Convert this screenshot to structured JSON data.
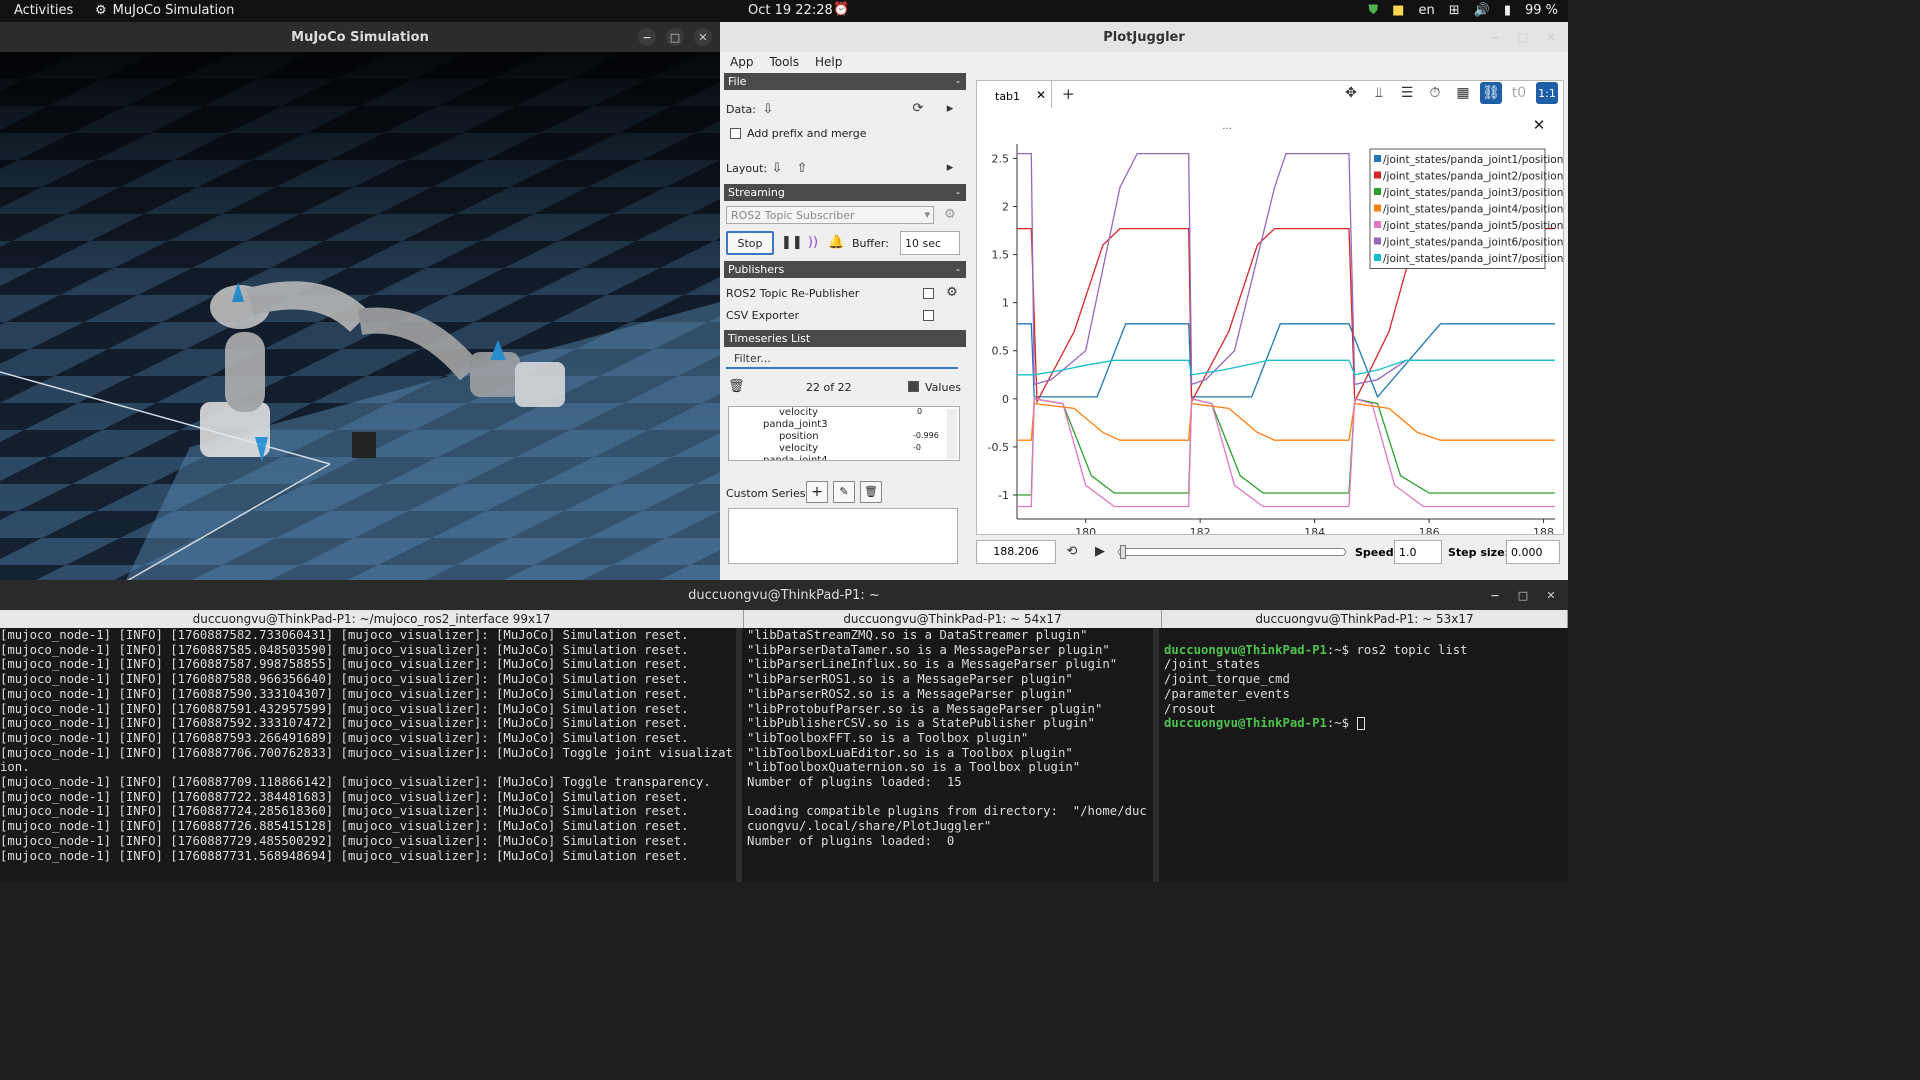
{
  "topbar": {
    "activities": "Activities",
    "app_name": "MuJoCo Simulation",
    "clock": "Oct 19  22:28",
    "lang": "en",
    "battery": "99 %"
  },
  "mujoco": {
    "title": "MuJoCo Simulation"
  },
  "plotjuggler": {
    "title": "PlotJuggler",
    "menu": [
      "App",
      "Tools",
      "Help"
    ],
    "file_section": "File",
    "data_label": "Data:",
    "prefix_label": "Add prefix and merge",
    "layout_label": "Layout:",
    "streaming_section": "Streaming",
    "streaming_source": "ROS2 Topic Subscriber",
    "stop_label": "Stop",
    "buffer_label": "Buffer:",
    "buffer_value": "10 sec",
    "publishers_section": "Publishers",
    "publishers": [
      "ROS2 Topic Re-Publisher",
      "CSV Exporter"
    ],
    "timeseries_section": "Timeseries List",
    "filter_placeholder": "Filter...",
    "count": "22 of 22",
    "values_label": "Values",
    "tree": [
      {
        "name": "velocity",
        "value": "0"
      },
      {
        "name": "panda_joint3",
        "value": ""
      },
      {
        "name": "position",
        "value": "-0.996"
      },
      {
        "name": "velocity",
        "value": "-0"
      },
      {
        "name": "panda_joint4",
        "value": ""
      }
    ],
    "custom_series_label": "Custom Series:",
    "tab_label": "tab1",
    "plot_dots": "...",
    "time_value": "188.206",
    "speed_label": "Speed:",
    "speed_value": "1.0",
    "step_label": "Step size:",
    "step_value": "0.000",
    "toolbar_zoom_label": "1:1"
  },
  "chart_data": {
    "type": "line",
    "title": "",
    "xlabel": "",
    "ylabel": "",
    "xlim": [
      178.8,
      188.2
    ],
    "ylim": [
      -1.25,
      2.65
    ],
    "xticks": [
      180,
      182,
      184,
      186,
      188
    ],
    "yticks": [
      2.5,
      2,
      1.5,
      1,
      0.5,
      0,
      -0.5,
      -1
    ],
    "legend_position": "top-right",
    "series": [
      {
        "name": "/joint_states/panda_joint1/position",
        "color": "#1f77b4",
        "x": [
          178.8,
          179.05,
          179.1,
          180.2,
          180.7,
          181.8,
          181.85,
          182.9,
          183.4,
          184.6,
          185.1,
          186.2,
          188.2
        ],
        "y": [
          0.78,
          0.78,
          0.02,
          0.02,
          0.78,
          0.78,
          0.02,
          0.02,
          0.78,
          0.78,
          0.02,
          0.78,
          0.78
        ]
      },
      {
        "name": "/joint_states/panda_joint2/position",
        "color": "#d62728",
        "x": [
          178.8,
          179.05,
          179.15,
          179.8,
          180.3,
          180.6,
          181.8,
          181.85,
          182.5,
          183.0,
          183.3,
          184.6,
          184.7,
          185.3,
          185.8,
          186.2,
          188.2
        ],
        "y": [
          1.77,
          1.77,
          -0.03,
          0.7,
          1.6,
          1.77,
          1.77,
          -0.03,
          0.7,
          1.6,
          1.77,
          1.77,
          -0.03,
          0.7,
          1.77,
          1.77,
          1.77
        ]
      },
      {
        "name": "/joint_states/panda_joint3/position",
        "color": "#2ca02c",
        "x": [
          178.8,
          179.05,
          179.1,
          179.6,
          180.1,
          180.5,
          181.8,
          181.85,
          182.2,
          182.7,
          183.1,
          184.6,
          184.7,
          185.1,
          185.5,
          186.0,
          188.2
        ],
        "y": [
          -1.0,
          -1.0,
          0.0,
          -0.05,
          -0.8,
          -0.98,
          -0.98,
          0.0,
          -0.05,
          -0.8,
          -0.98,
          -0.98,
          0.0,
          -0.05,
          -0.8,
          -0.98,
          -0.98
        ]
      },
      {
        "name": "/joint_states/panda_joint4/position",
        "color": "#ff7f0e",
        "x": [
          178.8,
          179.05,
          179.1,
          179.8,
          180.3,
          180.6,
          181.8,
          181.85,
          182.5,
          183.0,
          183.3,
          184.6,
          184.7,
          185.3,
          185.8,
          186.2,
          188.2
        ],
        "y": [
          -0.43,
          -0.43,
          -0.05,
          -0.1,
          -0.35,
          -0.43,
          -0.43,
          -0.05,
          -0.1,
          -0.35,
          -0.43,
          -0.43,
          -0.05,
          -0.1,
          -0.35,
          -0.43,
          -0.43
        ]
      },
      {
        "name": "/joint_states/panda_joint5/position",
        "color": "#e377c2",
        "x": [
          178.8,
          179.05,
          179.1,
          179.6,
          180.0,
          180.5,
          181.8,
          181.85,
          182.2,
          182.6,
          183.1,
          184.6,
          184.7,
          185.0,
          185.4,
          185.9,
          188.2
        ],
        "y": [
          -1.12,
          -1.12,
          0.0,
          -0.05,
          -0.9,
          -1.12,
          -1.12,
          0.0,
          -0.05,
          -0.9,
          -1.12,
          -1.12,
          0.0,
          -0.05,
          -0.9,
          -1.12,
          -1.12
        ]
      },
      {
        "name": "/joint_states/panda_joint6/position",
        "color": "#9467bd",
        "x": [
          178.8,
          179.05,
          179.1,
          179.4,
          180.0,
          180.6,
          180.9,
          181.8,
          181.85,
          182.1,
          182.6,
          183.3,
          183.5,
          184.6,
          184.7,
          185.1,
          185.6,
          186.2,
          188.2
        ],
        "y": [
          2.55,
          2.55,
          0.15,
          0.2,
          0.5,
          2.2,
          2.55,
          2.55,
          0.15,
          0.2,
          0.5,
          2.2,
          2.55,
          2.55,
          0.15,
          0.2,
          0.4,
          0.4,
          0.4
        ]
      },
      {
        "name": "/joint_states/panda_joint7/position",
        "color": "#17becf",
        "x": [
          178.8,
          179.05,
          179.1,
          179.6,
          180.0,
          180.5,
          181.8,
          181.85,
          182.4,
          182.8,
          183.2,
          184.6,
          184.7,
          185.1,
          185.6,
          186.0,
          188.2
        ],
        "y": [
          0.25,
          0.25,
          0.25,
          0.3,
          0.35,
          0.4,
          0.4,
          0.25,
          0.3,
          0.35,
          0.4,
          0.4,
          0.25,
          0.3,
          0.4,
          0.4,
          0.4
        ]
      }
    ]
  },
  "terminal": {
    "title": "duccuongvu@ThinkPad-P1: ~",
    "tabs": [
      "duccuongvu@ThinkPad-P1: ~/mujoco_ros2_interface 99x17",
      "duccuongvu@ThinkPad-P1: ~ 54x17",
      "duccuongvu@ThinkPad-P1: ~ 53x17"
    ],
    "pane1": [
      "[mujoco_node-1] [INFO] [1760887582.733060431] [mujoco_visualizer]: [MuJoCo] Simulation reset.",
      "[mujoco_node-1] [INFO] [1760887585.048503590] [mujoco_visualizer]: [MuJoCo] Simulation reset.",
      "[mujoco_node-1] [INFO] [1760887587.998758855] [mujoco_visualizer]: [MuJoCo] Simulation reset.",
      "[mujoco_node-1] [INFO] [1760887588.966356640] [mujoco_visualizer]: [MuJoCo] Simulation reset.",
      "[mujoco_node-1] [INFO] [1760887590.333104307] [mujoco_visualizer]: [MuJoCo] Simulation reset.",
      "[mujoco_node-1] [INFO] [1760887591.432957599] [mujoco_visualizer]: [MuJoCo] Simulation reset.",
      "[mujoco_node-1] [INFO] [1760887592.333107472] [mujoco_visualizer]: [MuJoCo] Simulation reset.",
      "[mujoco_node-1] [INFO] [1760887593.266491689] [mujoco_visualizer]: [MuJoCo] Simulation reset.",
      "[mujoco_node-1] [INFO] [1760887706.700762833] [mujoco_visualizer]: [MuJoCo] Toggle joint visualizat",
      "ion.",
      "[mujoco_node-1] [INFO] [1760887709.118866142] [mujoco_visualizer]: [MuJoCo] Toggle transparency.",
      "[mujoco_node-1] [INFO] [1760887722.384481683] [mujoco_visualizer]: [MuJoCo] Simulation reset.",
      "[mujoco_node-1] [INFO] [1760887724.285618360] [mujoco_visualizer]: [MuJoCo] Simulation reset.",
      "[mujoco_node-1] [INFO] [1760887726.885415128] [mujoco_visualizer]: [MuJoCo] Simulation reset.",
      "[mujoco_node-1] [INFO] [1760887729.485500292] [mujoco_visualizer]: [MuJoCo] Simulation reset.",
      "[mujoco_node-1] [INFO] [1760887731.568948694] [mujoco_visualizer]: [MuJoCo] Simulation reset."
    ],
    "pane2": [
      "\"libDataStreamZMQ.so is a DataStreamer plugin\"",
      "\"libParserDataTamer.so is a MessageParser plugin\"",
      "\"libParserLineInflux.so is a MessageParser plugin\"",
      "\"libParserROS1.so is a MessageParser plugin\"",
      "\"libParserROS2.so is a MessageParser plugin\"",
      "\"libProtobufParser.so is a MessageParser plugin\"",
      "\"libPublisherCSV.so is a StatePublisher plugin\"",
      "\"libToolboxFFT.so is a Toolbox plugin\"",
      "\"libToolboxLuaEditor.so is a Toolbox plugin\"",
      "\"libToolboxQuaternion.so is a Toolbox plugin\"",
      "Number of plugins loaded:  15",
      "",
      "Loading compatible plugins from directory:  \"/home/duc",
      "cuongvu/.local/share/PlotJuggler\"",
      "Number of plugins loaded:  0"
    ],
    "pane3_prompt": "duccuongvu@ThinkPad-P1",
    "pane3_cmd": ":~$ ros2 topic list",
    "pane3_out": [
      "/joint_states",
      "/joint_torque_cmd",
      "/parameter_events",
      "/rosout"
    ],
    "pane3_prompt_end": ":~$ "
  }
}
